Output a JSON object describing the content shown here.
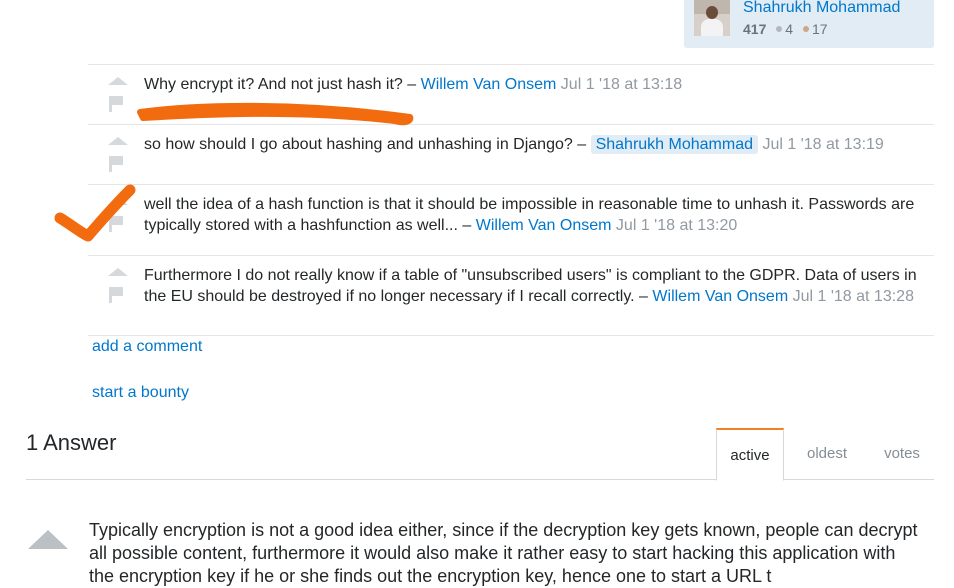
{
  "user_card": {
    "name": "Shahrukh Mohammad",
    "reputation": "417",
    "silver_badges": "4",
    "bronze_badges": "17"
  },
  "comments": [
    {
      "text": "Why encrypt it? And not just hash it? –",
      "author": "Willem Van Onsem",
      "time": "Jul 1 '18 at 13:18",
      "author_is_owner": false
    },
    {
      "text": "so how should I go about hashing and unhashing in Django? –",
      "author": "Shahrukh Mohammad",
      "time": "Jul 1 '18 at 13:19",
      "author_is_owner": true
    },
    {
      "text": "well the idea of a hash function is that it should be impossible in reasonable time to unhash it. Passwords are typically stored with a hashfunction as well... –",
      "author": "Willem Van Onsem",
      "time": "Jul 1 '18 at 13:20",
      "author_is_owner": false
    },
    {
      "text": "Furthermore I do not really know if a table of \"unsubscribed users\" is compliant to the GDPR. Data of users in the EU should be destroyed if no longer necessary if I recall correctly. –",
      "author": "Willem Van Onsem",
      "time": "Jul 1 '18 at 13:28",
      "author_is_owner": false
    }
  ],
  "links": {
    "add_comment": "add a comment",
    "start_bounty": "start a bounty"
  },
  "answers": {
    "count_label": "1 Answer",
    "tabs": [
      "active",
      "oldest",
      "votes"
    ],
    "active_tab": "active",
    "first_answer_text": "Typically encryption is not a good idea either, since if the decryption key gets known, people can decrypt all possible content, furthermore it would also make it rather easy to start hacking this application with the encryption key if he or she finds out the encryption key, hence one to start a URL t"
  },
  "colors": {
    "link": "#0077cc",
    "owner_bg": "#e1ecf4",
    "annotation": "#f26b0f",
    "tab_accent": "#f48024"
  }
}
